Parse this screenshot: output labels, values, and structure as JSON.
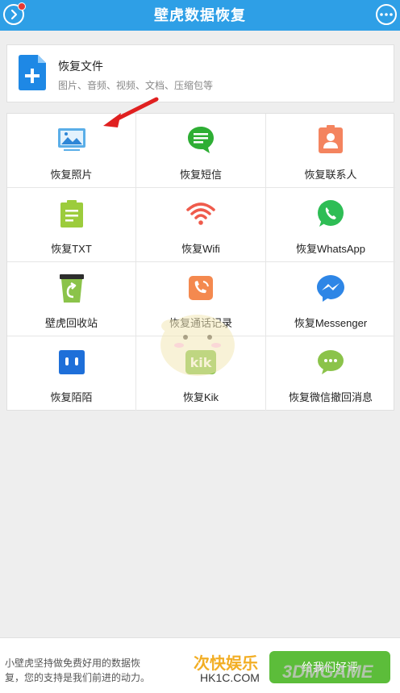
{
  "header": {
    "title": "壁虎数据恢复"
  },
  "recover_file": {
    "title": "恢复文件",
    "subtitle": "图片、音频、视频、文档、压缩包等"
  },
  "grid": [
    {
      "label": "恢复照片",
      "icon": "photo-icon"
    },
    {
      "label": "恢复短信",
      "icon": "sms-icon"
    },
    {
      "label": "恢复联系人",
      "icon": "contact-icon"
    },
    {
      "label": "恢复TXT",
      "icon": "txt-icon"
    },
    {
      "label": "恢复Wifi",
      "icon": "wifi-icon"
    },
    {
      "label": "恢复WhatsApp",
      "icon": "whatsapp-icon"
    },
    {
      "label": "壁虎回收站",
      "icon": "recycle-bin-icon"
    },
    {
      "label": "恢复通话记录",
      "icon": "call-log-icon"
    },
    {
      "label": "恢复Messenger",
      "icon": "messenger-icon"
    },
    {
      "label": "恢复陌陌",
      "icon": "momo-icon"
    },
    {
      "label": "恢复Kik",
      "icon": "kik-icon"
    },
    {
      "label": "恢复微信撤回消息",
      "icon": "wechat-icon"
    }
  ],
  "bottom": {
    "message": "小壁虎坚持做免费好用的数据恢复，您的支持是我们前进的动力。",
    "rate_button": "给我们好评"
  },
  "watermark": {
    "text": "次快娱乐",
    "sub": "HK1C.COM",
    "brand": "3DMGAME"
  },
  "colors": {
    "header": "#2e9fe6",
    "rate_button": "#5cbd3a",
    "arrow": "#e02020"
  }
}
